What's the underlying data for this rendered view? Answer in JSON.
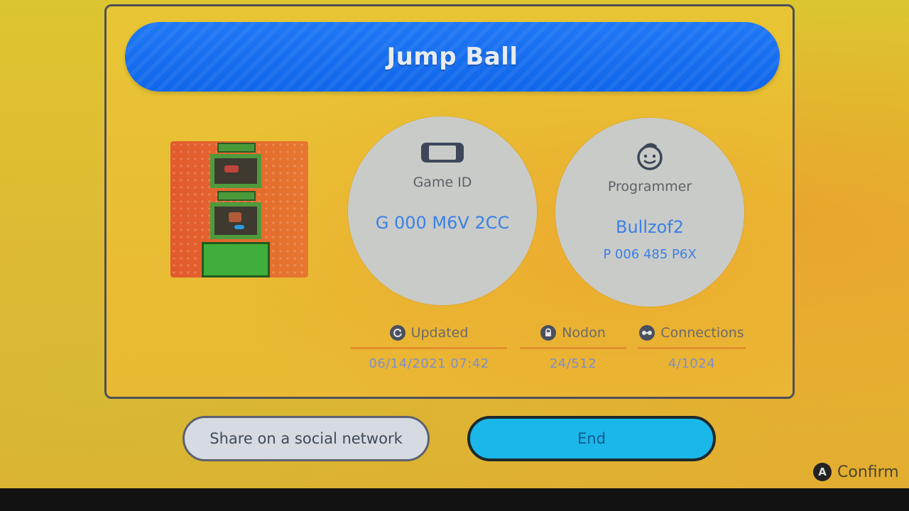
{
  "game": {
    "title": "Jump Ball",
    "game_id_label": "Game ID",
    "game_id": "G 000 M6V 2CC",
    "programmer_label": "Programmer",
    "programmer_name": "Bullzof2",
    "programmer_id": "P 006 485 P6X"
  },
  "stats": {
    "updated_label": "Updated",
    "updated_value": "06/14/2021 07:42",
    "nodon_label": "Nodon",
    "nodon_value": "24/512",
    "connections_label": "Connections",
    "connections_value": "4/1024"
  },
  "actions": {
    "share_label": "Share on a social network",
    "end_label": "End",
    "confirm_button": "A",
    "confirm_label": "Confirm"
  },
  "icons": {
    "game_id": "console-icon",
    "programmer": "face-icon",
    "updated": "refresh-icon",
    "nodon": "lock-icon",
    "connections": "link-icon"
  },
  "colors": {
    "title_bar": "#1f78f5",
    "end_button": "#1ab8ea",
    "accent_text": "#3c80e6",
    "stat_rule": "#e58e2b"
  }
}
